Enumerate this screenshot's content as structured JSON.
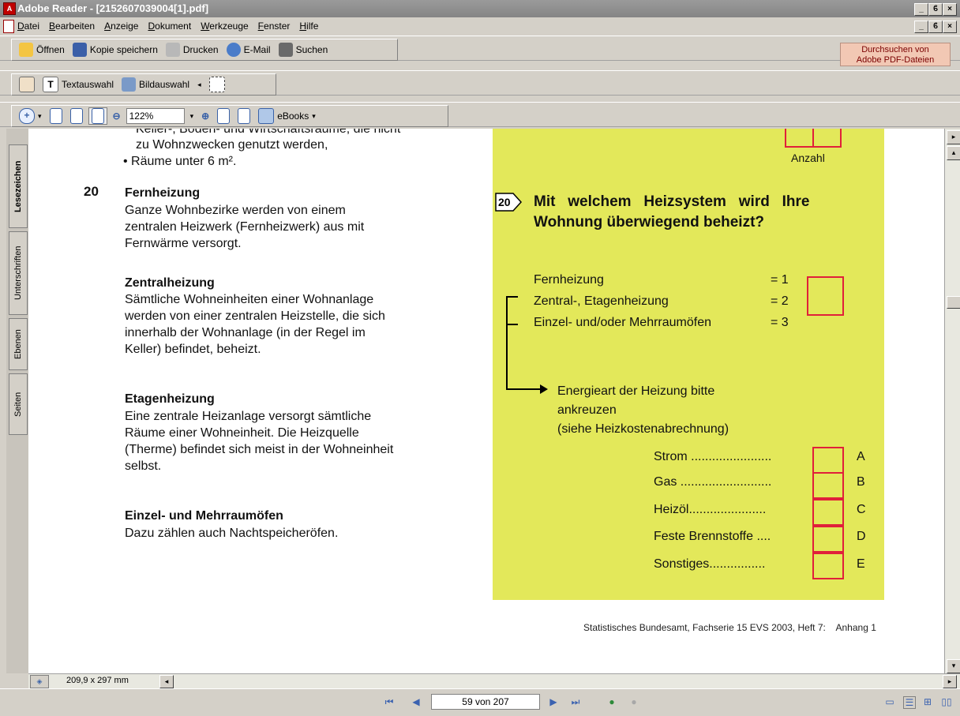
{
  "window": {
    "title": "Adobe Reader - [2152607039004[1].pdf]",
    "controls": [
      "_",
      "ϐ",
      "×"
    ]
  },
  "menu": {
    "items": [
      "Datei",
      "Bearbeiten",
      "Anzeige",
      "Dokument",
      "Werkzeuge",
      "Fenster",
      "Hilfe"
    ]
  },
  "toolbar1": {
    "open": "Öffnen",
    "save_copy": "Kopie speichern",
    "print": "Drucken",
    "email": "E-Mail",
    "search": "Suchen",
    "search_adobe_line1": "Durchsuchen von",
    "search_adobe_line2": "Adobe PDF-Dateien"
  },
  "toolbar2": {
    "text_select": "Textauswahl",
    "image_select": "Bildauswahl"
  },
  "toolbar3": {
    "zoom": "122%",
    "ebooks": "eBooks"
  },
  "side_tabs": [
    "Lesezeichen",
    "Unterschriften",
    "Ebenen",
    "Seiten"
  ],
  "document": {
    "left": {
      "top_partial": "Keller-, Boden- und Wirtschaftsräume, die nicht",
      "top_line2": "zu Wohnzwecken genutzt werden,",
      "top_bullet": "• Räume unter 6 m².",
      "section_number": "20",
      "fern_title": "Fernheizung",
      "fern_body": [
        "Ganze Wohnbezirke werden von einem",
        "zentralen Heizwerk (Fernheizwerk) aus mit",
        "Fernwärme versorgt."
      ],
      "zentral_title": "Zentralheizung",
      "zentral_body": [
        "Sämtliche Wohneinheiten einer Wohnanlage",
        "werden von einer zentralen Heizstelle, die sich",
        "innerhalb der Wohnanlage (in der Regel im",
        "Keller) befindet, beheizt."
      ],
      "etagen_title": "Etagenheizung",
      "etagen_body": [
        "Eine zentrale Heizanlage versorgt  sämtliche",
        "Räume einer Wohneinheit. Die Heizquelle",
        "(Therme) befindet sich meist in der Wohneinheit",
        "selbst."
      ],
      "einzel_title": "Einzel- und Mehrraumöfen",
      "einzel_body": [
        "Dazu zählen auch Nachtspeicheröfen."
      ]
    },
    "right": {
      "anzahl": "Anzahl",
      "q_number": "20",
      "question_line1": "Mit   welchem   Heizsystem   wird   Ihre",
      "question_line2": "Wohnung überwiegend beheizt?",
      "options": [
        {
          "label": "Fernheizung",
          "code": "= 1"
        },
        {
          "label": "Zentral-, Etagenheizung",
          "code": "= 2"
        },
        {
          "label": "Einzel- und/oder Mehrraumöfen",
          "code": "= 3"
        }
      ],
      "energy_line1": "Energieart der Heizung bitte",
      "energy_line2": "ankreuzen",
      "energy_line3": "(siehe Heizkostenabrechnung)",
      "energy": [
        {
          "label": "Strom .......................",
          "letter": "A"
        },
        {
          "label": "Gas ..........................",
          "letter": "B"
        },
        {
          "label": "Heizöl......................",
          "letter": "C"
        },
        {
          "label": "Feste Brennstoffe ....",
          "letter": "D"
        },
        {
          "label": "Sonstiges................",
          "letter": "E"
        }
      ]
    },
    "footer": "Statistisches Bundesamt, Fachserie 15 EVS 2003, Heft 7:    Anhang 1"
  },
  "status": {
    "page_size": "209,9 x 297 mm",
    "page_indicator": "59 von 207"
  }
}
